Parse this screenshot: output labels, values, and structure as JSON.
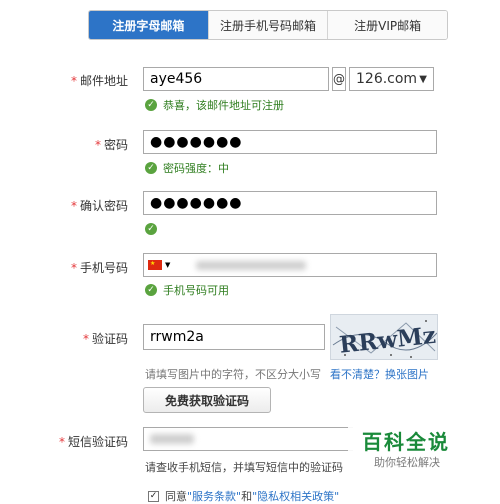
{
  "tabs": [
    {
      "label": "注册字母邮箱",
      "active": true
    },
    {
      "label": "注册手机号码邮箱",
      "active": false
    },
    {
      "label": "注册VIP邮箱",
      "active": false
    }
  ],
  "required_mark": "*",
  "email": {
    "label": "邮件地址",
    "value": "aye456",
    "at": "@",
    "domain": "126.com",
    "tip": "恭喜，该邮件地址可注册"
  },
  "password": {
    "label": "密码",
    "value": "●●●●●●●",
    "tip": "密码强度：中"
  },
  "confirm_password": {
    "label": "确认密码",
    "value": "●●●●●●●"
  },
  "phone": {
    "label": "手机号码",
    "country_flag": "cn-flag-icon",
    "tip": "手机号码可用"
  },
  "captcha": {
    "label": "验证码",
    "value": "rrwm2a",
    "image_text": "RRwMza",
    "hint": "请填写图片中的字符，不区分大小写",
    "refresh_link": "看不清楚？换张图片",
    "sms_button": "免费获取验证码"
  },
  "sms_code": {
    "label": "短信验证码",
    "hint": "请查收手机短信，并填写短信中的验证码"
  },
  "agreement": {
    "prefix": "同意",
    "terms": "\"服务条款\"",
    "and": "和",
    "privacy": "\"隐私权相关政策\""
  },
  "watermark": {
    "title": "百科全说",
    "subtitle": "助你轻松解决"
  },
  "colors": {
    "accent": "#2d74c7",
    "success": "#5aa33f",
    "required": "#e4393c",
    "watermark": "#1a8a3a"
  }
}
